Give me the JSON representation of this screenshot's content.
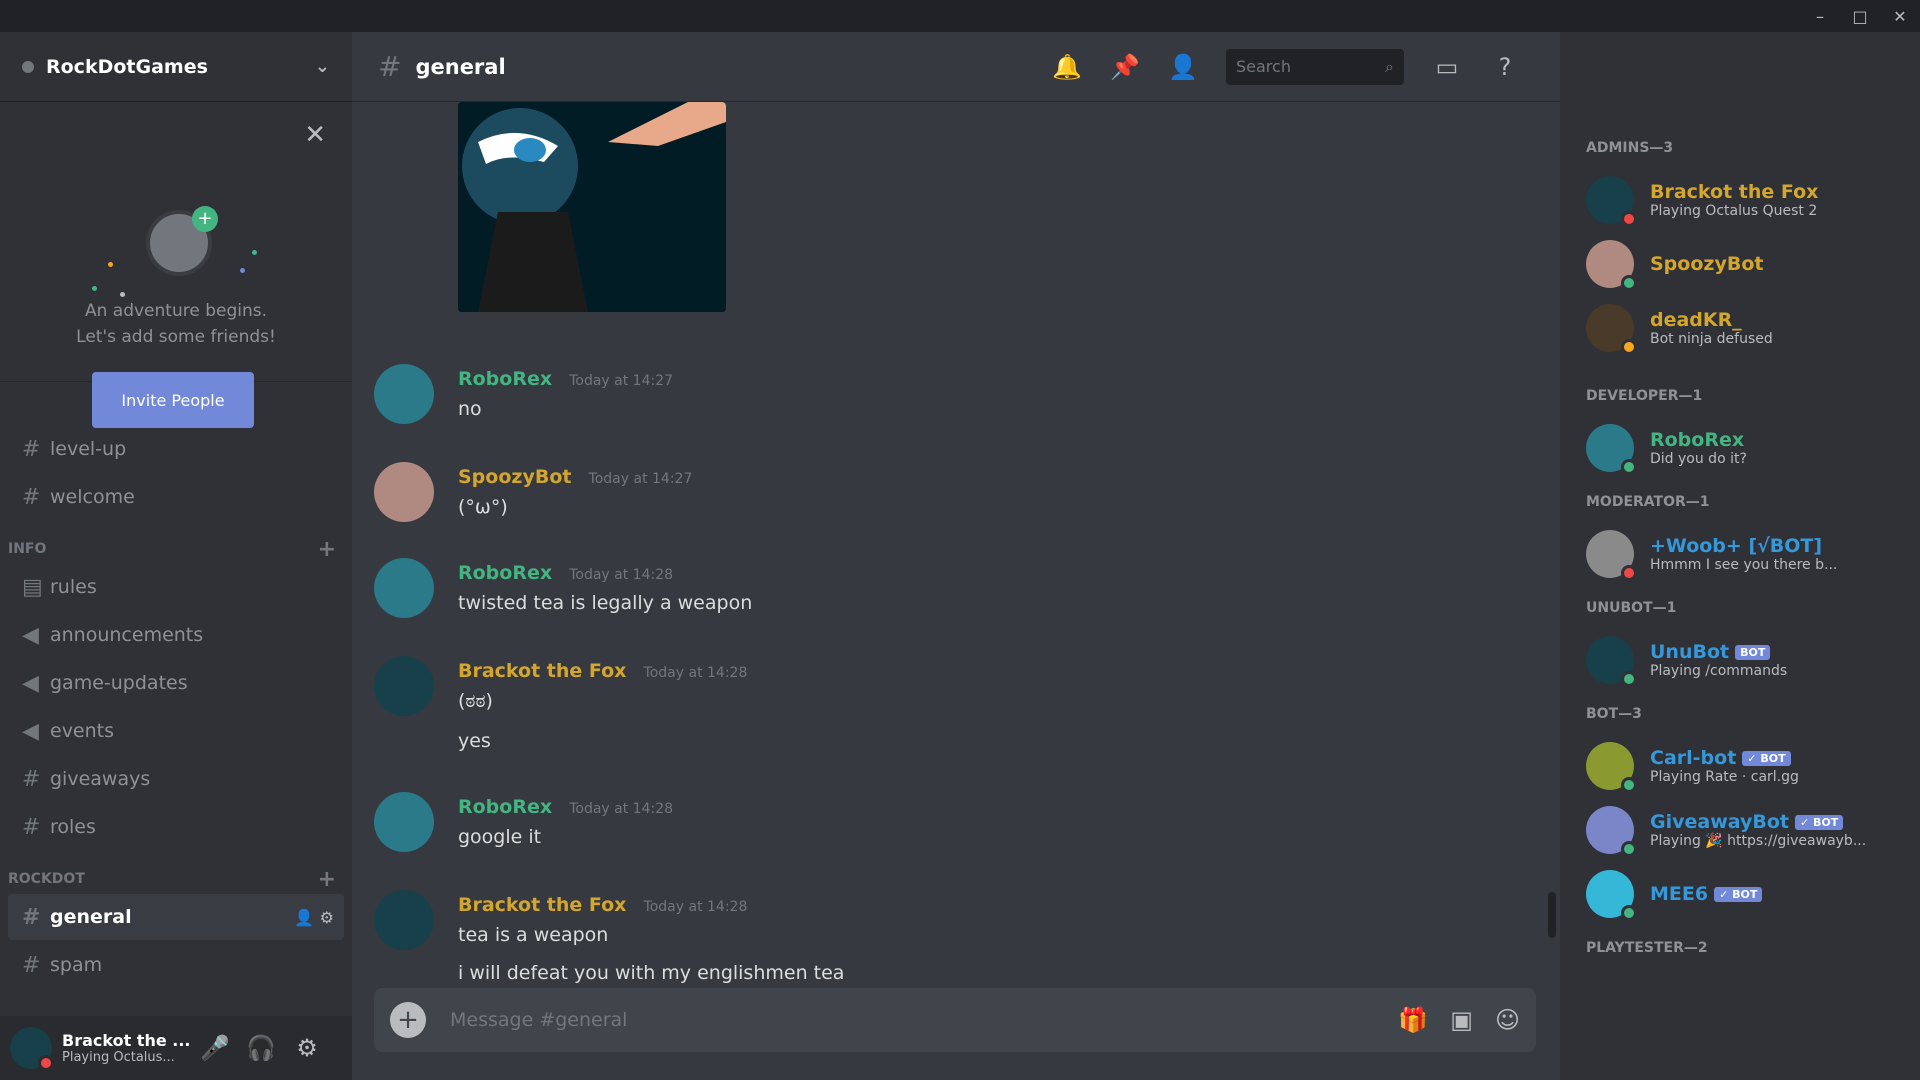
{
  "window": {
    "minimize": "–",
    "maximize": "□",
    "close": "✕"
  },
  "guild": {
    "name": "RockDotGames"
  },
  "invite": {
    "line1": "An adventure begins.",
    "line2": "Let's add some friends!",
    "button": "Invite People"
  },
  "channels": {
    "top": [
      {
        "name": "level-up"
      },
      {
        "name": "welcome"
      }
    ],
    "info_category": "INFO",
    "info": [
      {
        "name": "rules"
      },
      {
        "name": "announcements"
      },
      {
        "name": "game-updates"
      },
      {
        "name": "events"
      },
      {
        "name": "giveaways"
      },
      {
        "name": "roles"
      }
    ],
    "rockdot_category": "ROCKDOT",
    "rockdot": [
      {
        "name": "general"
      },
      {
        "name": "spam"
      }
    ]
  },
  "user_panel": {
    "name": "Brackot the ...",
    "status": "Playing Octalus..."
  },
  "header": {
    "channel": "general",
    "search_placeholder": "Search"
  },
  "messages": [
    {
      "author": "RoboRex",
      "color": "#43b581",
      "time": "Today at 14:27",
      "lines": [
        "no"
      ]
    },
    {
      "author": "SpoozyBot",
      "color": "#d4a72c",
      "time": "Today at 14:27",
      "lines": [
        "(°ω°)"
      ]
    },
    {
      "author": "RoboRex",
      "color": "#43b581",
      "time": "Today at 14:28",
      "lines": [
        "twisted tea is legally a weapon"
      ]
    },
    {
      "author": "Brackot the Fox",
      "color": "#d4a72c",
      "time": "Today at 14:28",
      "lines": [
        "(ಠಠ)",
        "yes"
      ]
    },
    {
      "author": "RoboRex",
      "color": "#43b581",
      "time": "Today at 14:28",
      "lines": [
        "google it"
      ]
    },
    {
      "author": "Brackot the Fox",
      "color": "#d4a72c",
      "time": "Today at 14:28",
      "lines": [
        "tea is a weapon",
        "i will defeat you with my englishmen tea"
      ]
    }
  ],
  "composer": {
    "placeholder": "Message #general"
  },
  "members": {
    "roles": [
      {
        "title": "ADMINS—3",
        "members": [
          {
            "name": "Brackot the Fox",
            "activity": "Playing Octalus Quest 2",
            "color": "#d4a72c",
            "status": "#f04747",
            "badge": ""
          },
          {
            "name": "SpoozyBot",
            "activity": "",
            "color": "#d4a72c",
            "status": "#43b581",
            "badge": ""
          },
          {
            "name": "deadKR_",
            "activity": "Bot ninja defused",
            "color": "#d4a72c",
            "status": "#faa61a",
            "badge": ""
          }
        ]
      },
      {
        "title": "DEVELOPER—1",
        "members": [
          {
            "name": "RoboRex",
            "activity": "Did you do it?",
            "color": "#43b581",
            "status": "#43b581",
            "badge": ""
          }
        ]
      },
      {
        "title": "MODERATOR—1",
        "members": [
          {
            "name": "+Woob+ [√BOT]",
            "activity": "Hmmm I see you there b...",
            "color": "#3498db",
            "status": "#f04747",
            "badge": ""
          }
        ]
      },
      {
        "title": "UNUBOT—1",
        "members": [
          {
            "name": "UnuBot",
            "activity": "Playing /commands",
            "color": "#3498db",
            "status": "#43b581",
            "badge": "BOT"
          }
        ]
      },
      {
        "title": "BOT—3",
        "members": [
          {
            "name": "Carl-bot",
            "activity": "Playing Rate · carl.gg",
            "color": "#3498db",
            "status": "#43b581",
            "badge": "✓ BOT"
          },
          {
            "name": "GiveawayBot",
            "activity": "Playing 🎉 https://giveawayb...",
            "color": "#3498db",
            "status": "#43b581",
            "badge": "✓ BOT"
          },
          {
            "name": "MEE6",
            "activity": "",
            "color": "#3498db",
            "status": "#43b581",
            "badge": "✓ BOT"
          }
        ]
      },
      {
        "title": "PLAYTESTER—2",
        "members": []
      }
    ]
  }
}
